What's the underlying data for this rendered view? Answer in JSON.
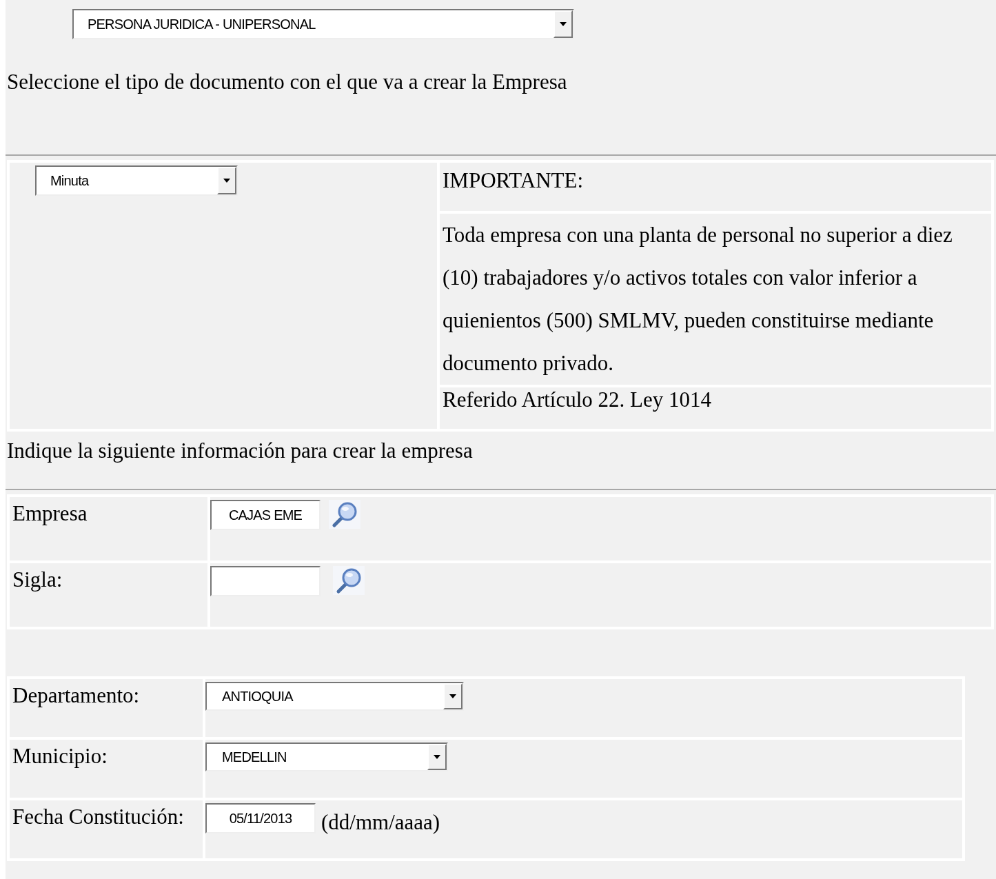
{
  "company_type_select": {
    "value": "PERSONA JURIDICA - UNIPERSONAL"
  },
  "document_prompt": "Seleccione el tipo de documento con el que va a crear la Empresa",
  "document_type_select": {
    "value": "Minuta"
  },
  "notice": {
    "title": "IMPORTANTE:",
    "lines": [
      "Toda empresa con una planta de personal no superior a diez",
      "(10) trabajadores y/o activos totales con valor inferior a",
      "quienientos (500) SMLMV, pueden constituirse mediante",
      "documento privado."
    ],
    "reference": "Referido Artículo 22. Ley 1014"
  },
  "info_prompt": "Indique la siguiente información para crear la empresa",
  "company_fields": [
    {
      "label": "Empresa",
      "value": "CAJAS EME",
      "search": true
    },
    {
      "label": "Sigla:",
      "search": true
    }
  ],
  "location_fields": [
    {
      "label": "Departamento:",
      "kind": "select",
      "value": "ANTIOQUIA"
    },
    {
      "label": "Municipio:",
      "kind": "select",
      "value": "MEDELLIN"
    },
    {
      "label": "Fecha Constitución:",
      "kind": "date",
      "value": "05/11/2013",
      "hint": "(dd/mm/aaaa)"
    }
  ]
}
